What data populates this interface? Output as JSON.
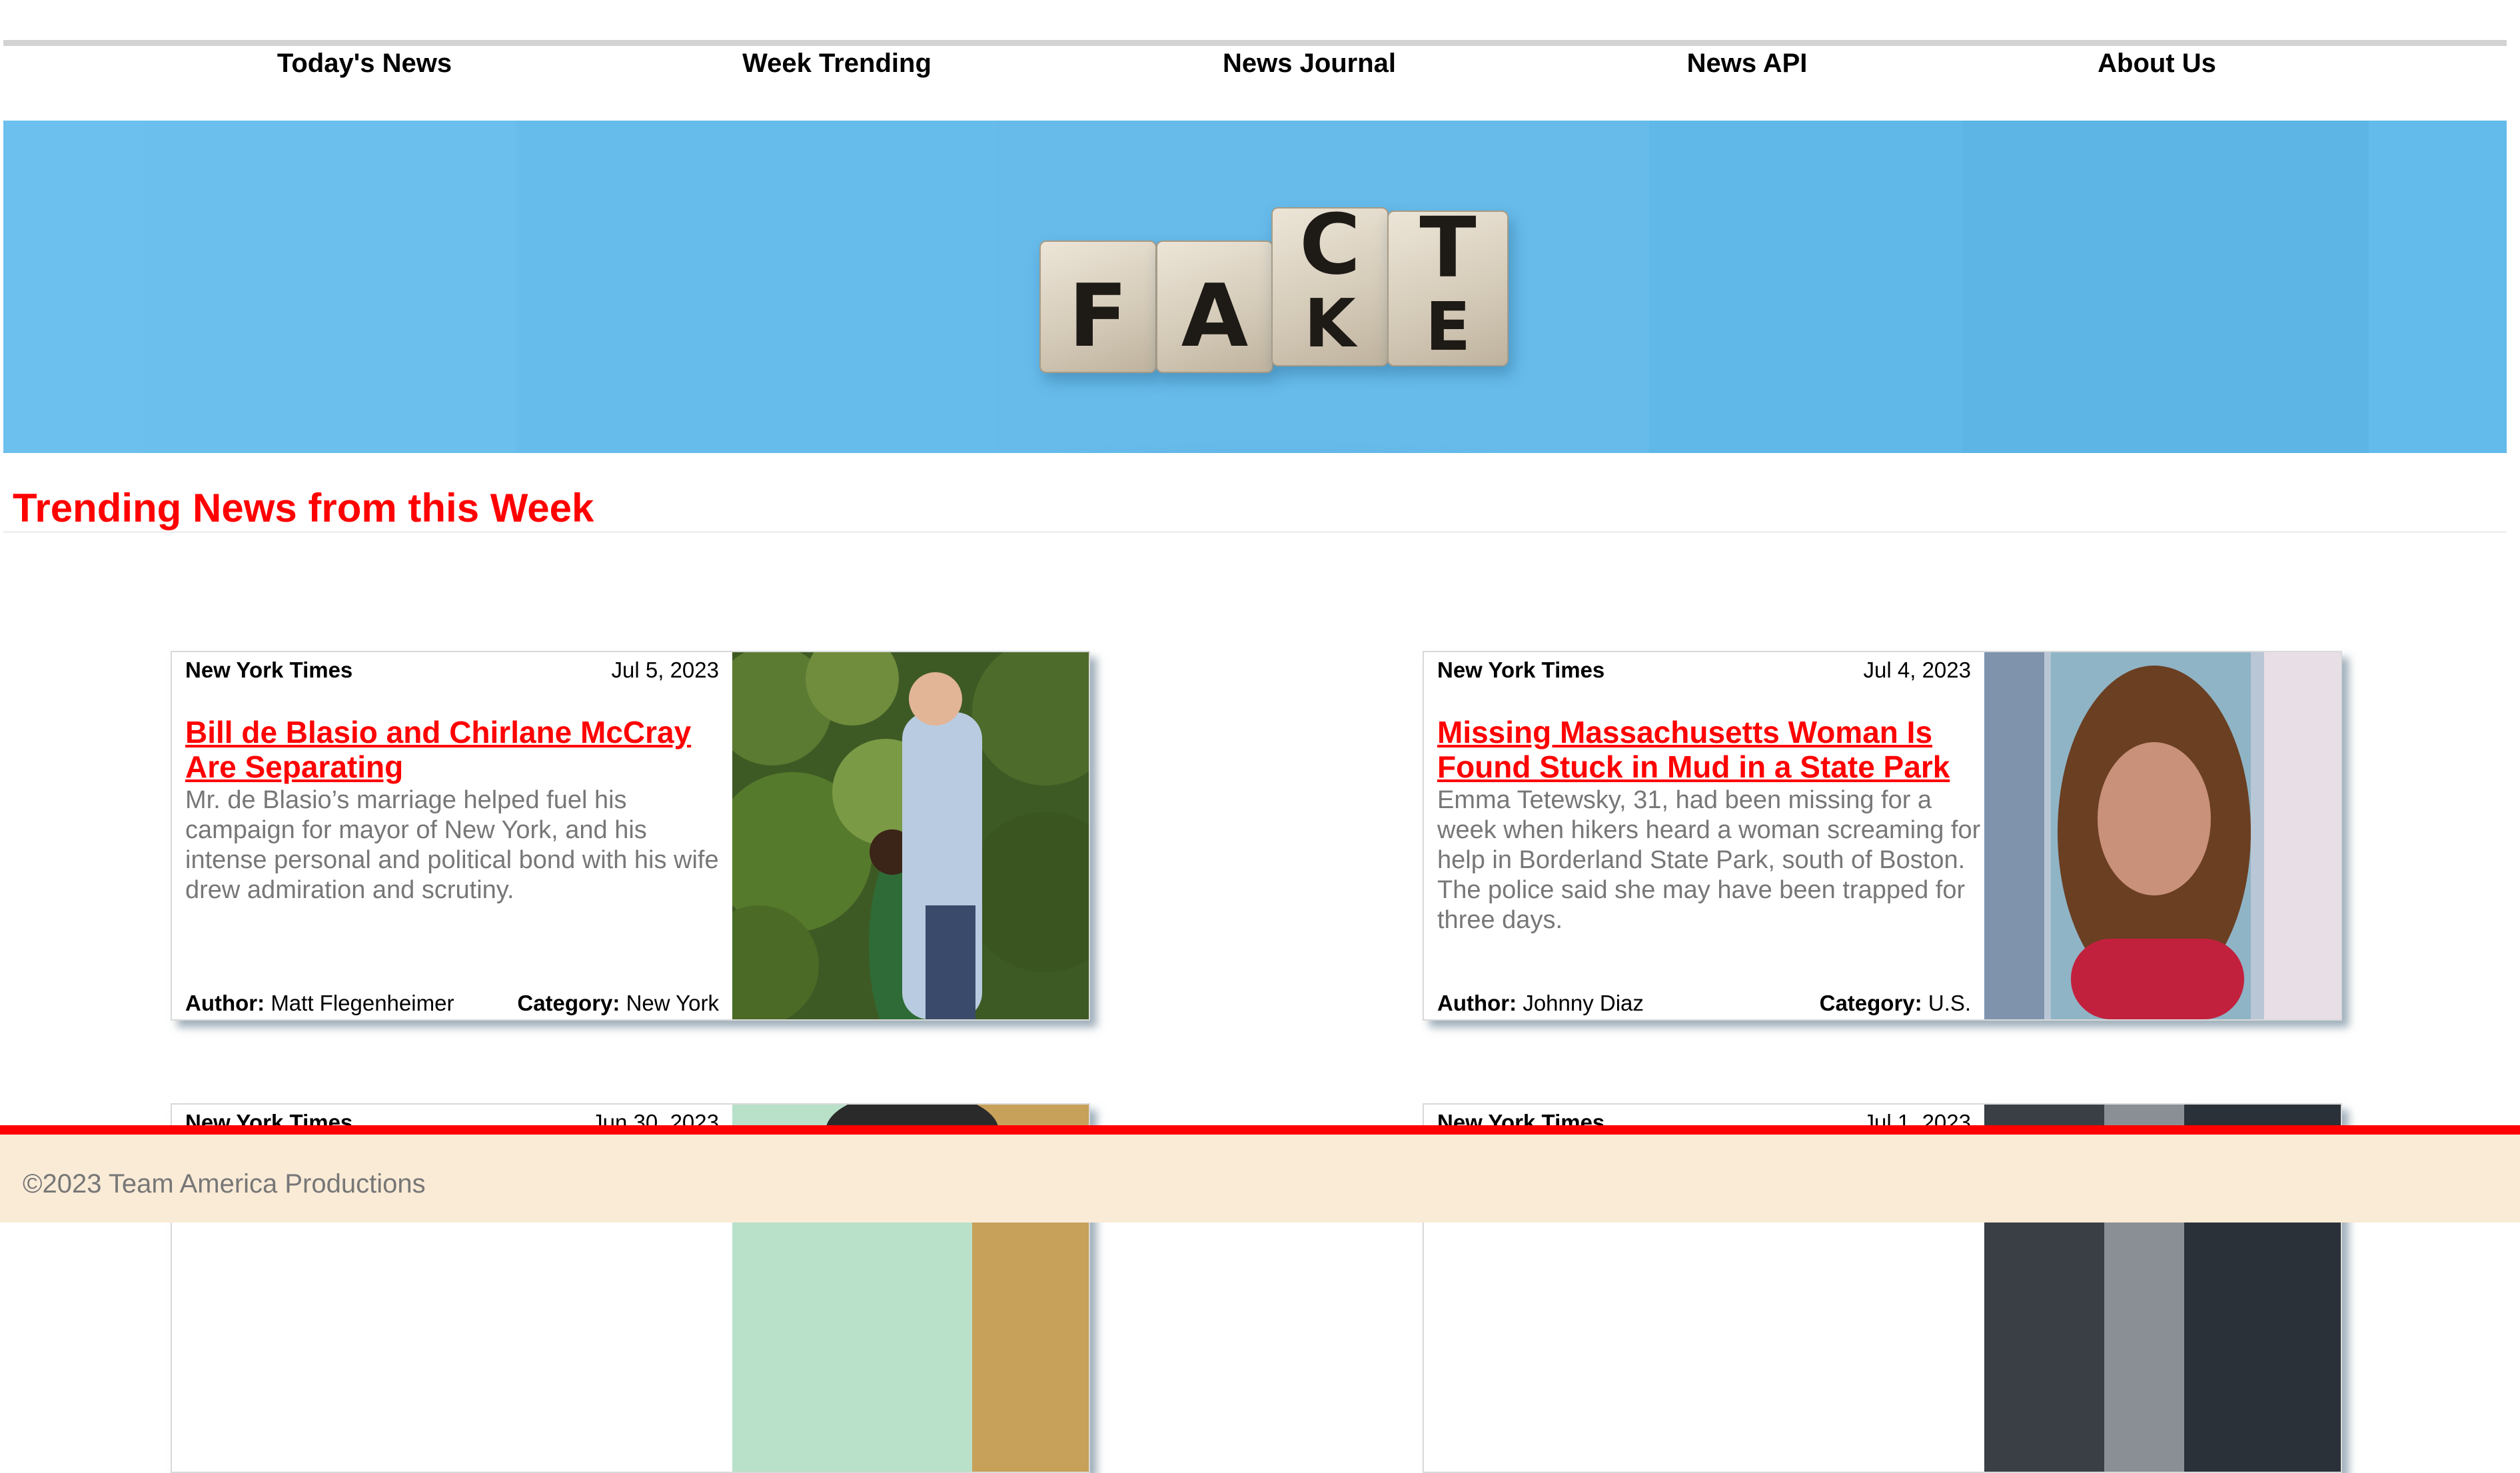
{
  "nav": {
    "items": [
      "Today's News",
      "Week Trending",
      "News Journal",
      "News API",
      "About Us"
    ]
  },
  "banner": {
    "top_row_letters": [
      "C",
      "T"
    ],
    "bottom_row_letters": [
      "F",
      "A",
      "K",
      "E"
    ],
    "background_color": "#66bbea"
  },
  "section": {
    "title": "Trending News from this Week",
    "title_color": "#ff0000"
  },
  "articles": [
    {
      "source": "New York Times",
      "date": "Jul 5, 2023",
      "headline": "Bill de Blasio and Chirlane McCray Are Separating",
      "summary": "Mr. de Blasio’s marriage helped fuel his campaign for mayor of New York, and his intense personal and political bond with his wife drew admiration and scrutiny.",
      "author_label": "Author:",
      "author": "Matt Flegenheimer",
      "category_label": "Category:",
      "category": "New York",
      "image_icon": "couple-photo"
    },
    {
      "source": "New York Times",
      "date": "Jul 4, 2023",
      "headline": "Missing Massachusetts Woman Is Found Stuck in Mud in a State Park",
      "summary": "Emma Tetewsky, 31, had been missing for a week when hikers heard a woman screaming for help in Borderland State Park, south of Boston. The police said she may have been trapped for three days.",
      "author_label": "Author:",
      "author": "Johnny Diaz",
      "category_label": "Category:",
      "category": "U.S.",
      "image_icon": "woman-portrait-photo"
    },
    {
      "source": "New York Times",
      "date": "Jun 30, 2023",
      "image_icon": "person-photo"
    },
    {
      "source": "New York Times",
      "date": "Jul 1, 2023",
      "image_icon": "person-photo"
    }
  ],
  "footer": {
    "text": "©2023 Team America Productions",
    "line_color": "#ff0000",
    "background_color": "#faebd7"
  }
}
